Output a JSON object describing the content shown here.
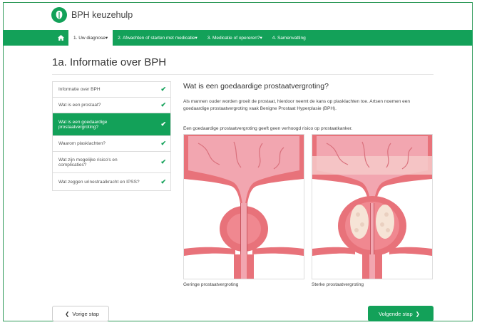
{
  "app": {
    "title": "BPH keuzehulp"
  },
  "nav": {
    "items": [
      {
        "label": "1. Uw diagnose",
        "active": true
      },
      {
        "label": "2. Afwachten of starten met medicatie",
        "active": false
      },
      {
        "label": "3. Medicatie of opereren?",
        "active": false
      },
      {
        "label": "4. Samenvatting",
        "active": false
      }
    ]
  },
  "page": {
    "title": "1a. Informatie over BPH"
  },
  "steps": [
    {
      "label": "Informatie over BPH",
      "done": true,
      "active": false
    },
    {
      "label": "Wat is een prostaat?",
      "done": true,
      "active": false
    },
    {
      "label": "Wat is een goedaardige prostaatvergroting?",
      "done": true,
      "active": true
    },
    {
      "label": "Waarom plasklachten?",
      "done": true,
      "active": false
    },
    {
      "label": "Wat zijn mogelijke risico's en complicaties?",
      "done": true,
      "active": false
    },
    {
      "label": "Wat zeggen urinestraalkracht en IPSS?",
      "done": true,
      "active": false
    }
  ],
  "content": {
    "title": "Wat is een goedaardige prostaatvergroting?",
    "para1": "Als mannen ouder worden groeit de prostaat, hierdoor neemt de kans op plasklachten toe. Artsen noemen een goedaardige prostaatvergroting vaak Benigne Prostaat Hyperplasie (BPH).",
    "para2": "Een goedaardige prostaatvergroting geeft geen verhoogd risico op prostaatkanker.",
    "figures": [
      {
        "caption": "Geringe prostaatvergroting"
      },
      {
        "caption": "Sterke prostaatvergroting"
      }
    ]
  },
  "buttons": {
    "prev": "Vorige stap",
    "next": "Volgende stap"
  },
  "colors": {
    "brand": "#13a159",
    "tissue": "#e8727a",
    "mucosa": "#f2a6b0"
  }
}
